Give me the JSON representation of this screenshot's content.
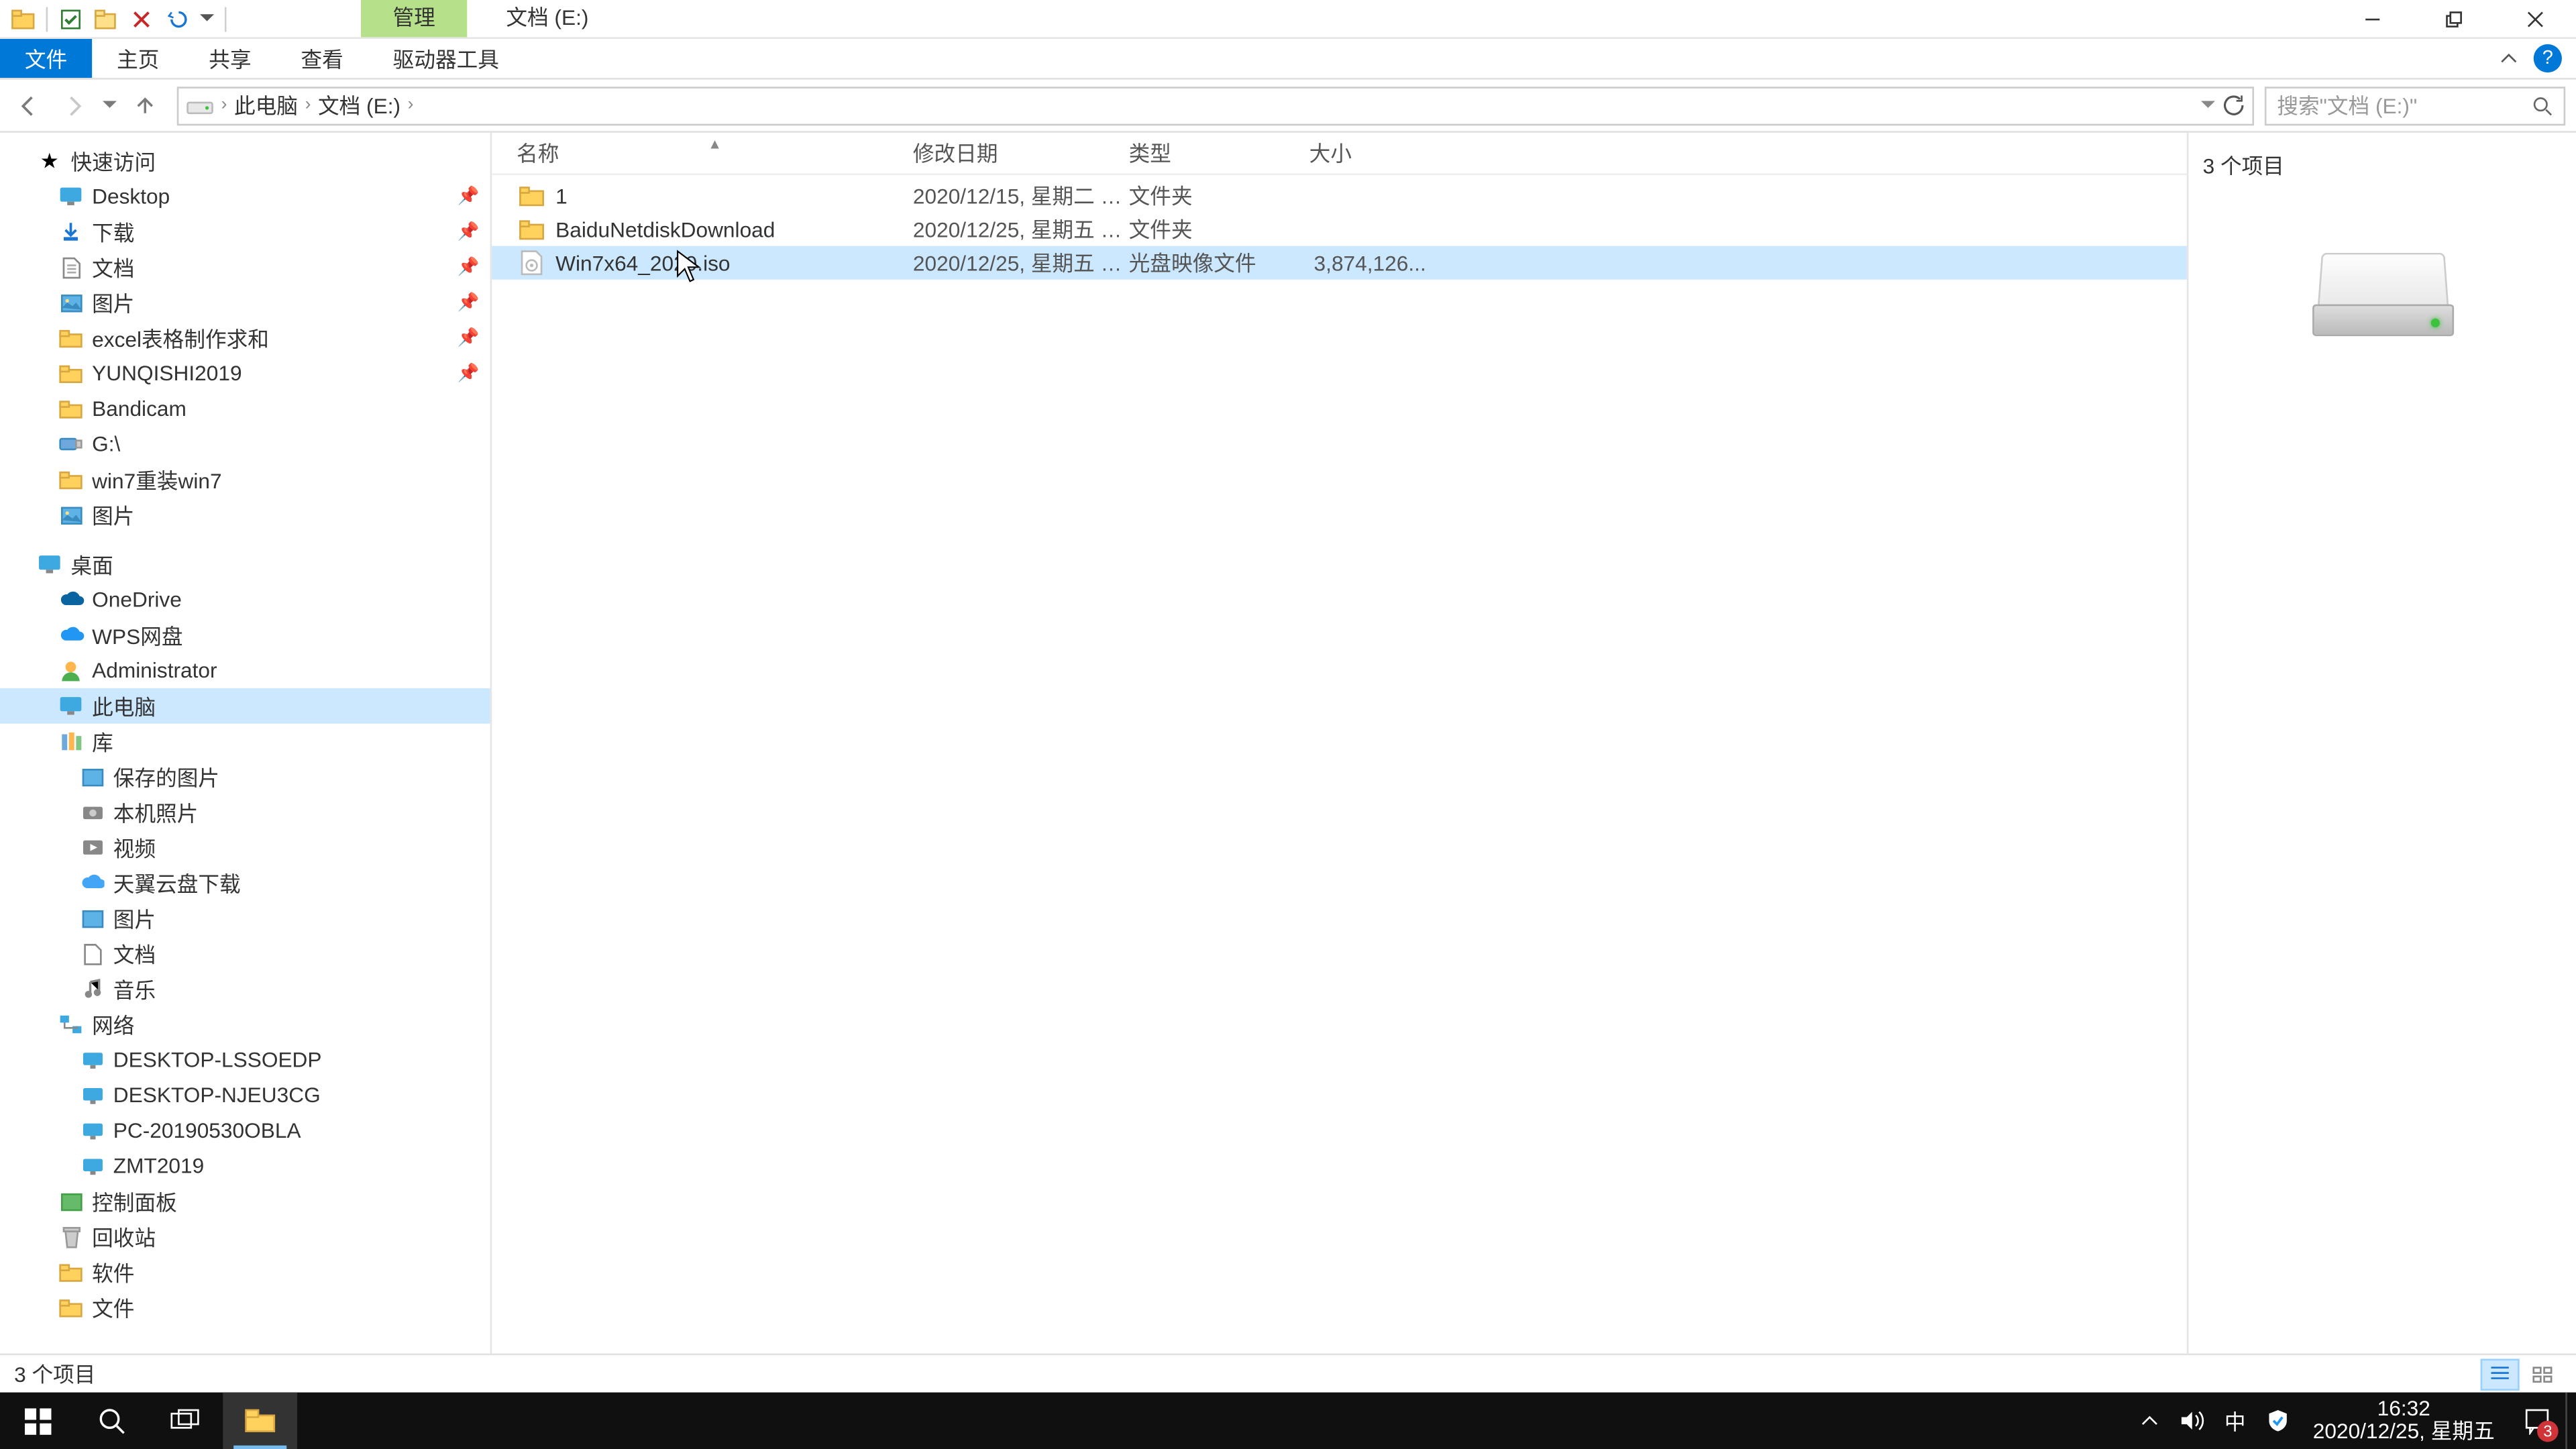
{
  "title": {
    "context_tab": "管理",
    "location_tab": "文档 (E:)"
  },
  "ribbon": {
    "file": "文件",
    "home": "主页",
    "share": "共享",
    "view": "查看",
    "drive_tools": "驱动器工具"
  },
  "breadcrumbs": {
    "this_pc": "此电脑",
    "docs": "文档 (E:)"
  },
  "search": {
    "placeholder": "搜索\"文档 (E:)\""
  },
  "tree": {
    "quick_access": "快速访问",
    "items_qa": [
      {
        "label": "Desktop"
      },
      {
        "label": "下载"
      },
      {
        "label": "文档"
      },
      {
        "label": "图片"
      },
      {
        "label": "excel表格制作求和"
      },
      {
        "label": "YUNQISHI2019"
      },
      {
        "label": "Bandicam"
      },
      {
        "label": "G:\\"
      },
      {
        "label": "win7重装win7"
      },
      {
        "label": "图片"
      }
    ],
    "desktop": "桌面",
    "onedrive": "OneDrive",
    "wps": "WPS网盘",
    "admin": "Administrator",
    "this_pc": "此电脑",
    "libraries": "库",
    "libs": [
      {
        "label": "保存的图片"
      },
      {
        "label": "本机照片"
      },
      {
        "label": "视频"
      },
      {
        "label": "天翼云盘下载"
      },
      {
        "label": "图片"
      },
      {
        "label": "文档"
      },
      {
        "label": "音乐"
      }
    ],
    "network": "网络",
    "nets": [
      {
        "label": "DESKTOP-LSSOEDP"
      },
      {
        "label": "DESKTOP-NJEU3CG"
      },
      {
        "label": "PC-20190530OBLA"
      },
      {
        "label": "ZMT2019"
      }
    ],
    "control_panel": "控制面板",
    "recycle": "回收站",
    "soft": "软件",
    "file": "文件"
  },
  "columns": {
    "name": "名称",
    "date": "修改日期",
    "type": "类型",
    "size": "大小"
  },
  "rows": [
    {
      "icon": "folder",
      "name": "1",
      "date": "2020/12/15, 星期二 1...",
      "type": "文件夹",
      "size": ""
    },
    {
      "icon": "folder",
      "name": "BaiduNetdiskDownload",
      "date": "2020/12/25, 星期五 1...",
      "type": "文件夹",
      "size": ""
    },
    {
      "icon": "iso",
      "name": "Win7x64_2020.iso",
      "date": "2020/12/25, 星期五 1...",
      "type": "光盘映像文件",
      "size": "3,874,126..."
    }
  ],
  "preview": {
    "count": "3 个项目"
  },
  "status": {
    "left": "3 个项目"
  },
  "taskbar": {
    "clock_time": "16:32",
    "clock_date": "2020/12/25, 星期五",
    "ime": "中",
    "badge": "3"
  }
}
